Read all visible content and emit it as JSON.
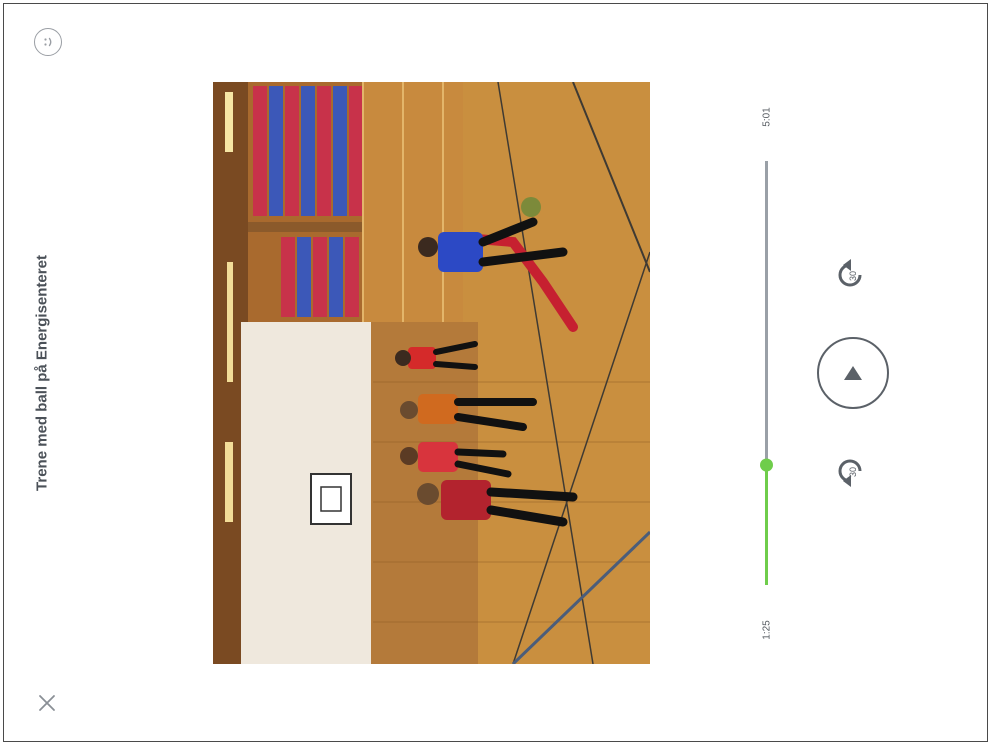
{
  "player": {
    "title": "Trene med ball på Energisenteret",
    "time_total": "5:01",
    "time_current": "1:25",
    "progress_fraction": 0.282,
    "skip_label": "30",
    "colors": {
      "accent": "#6fcd4b",
      "track": "#9aa0a7",
      "icon": "#5b6168"
    }
  },
  "icons": {
    "feedback": "smiley-face-icon",
    "close": "close-icon",
    "play": "play-icon",
    "skip_forward": "skip-forward-30-icon",
    "skip_back": "skip-back-30-icon"
  }
}
